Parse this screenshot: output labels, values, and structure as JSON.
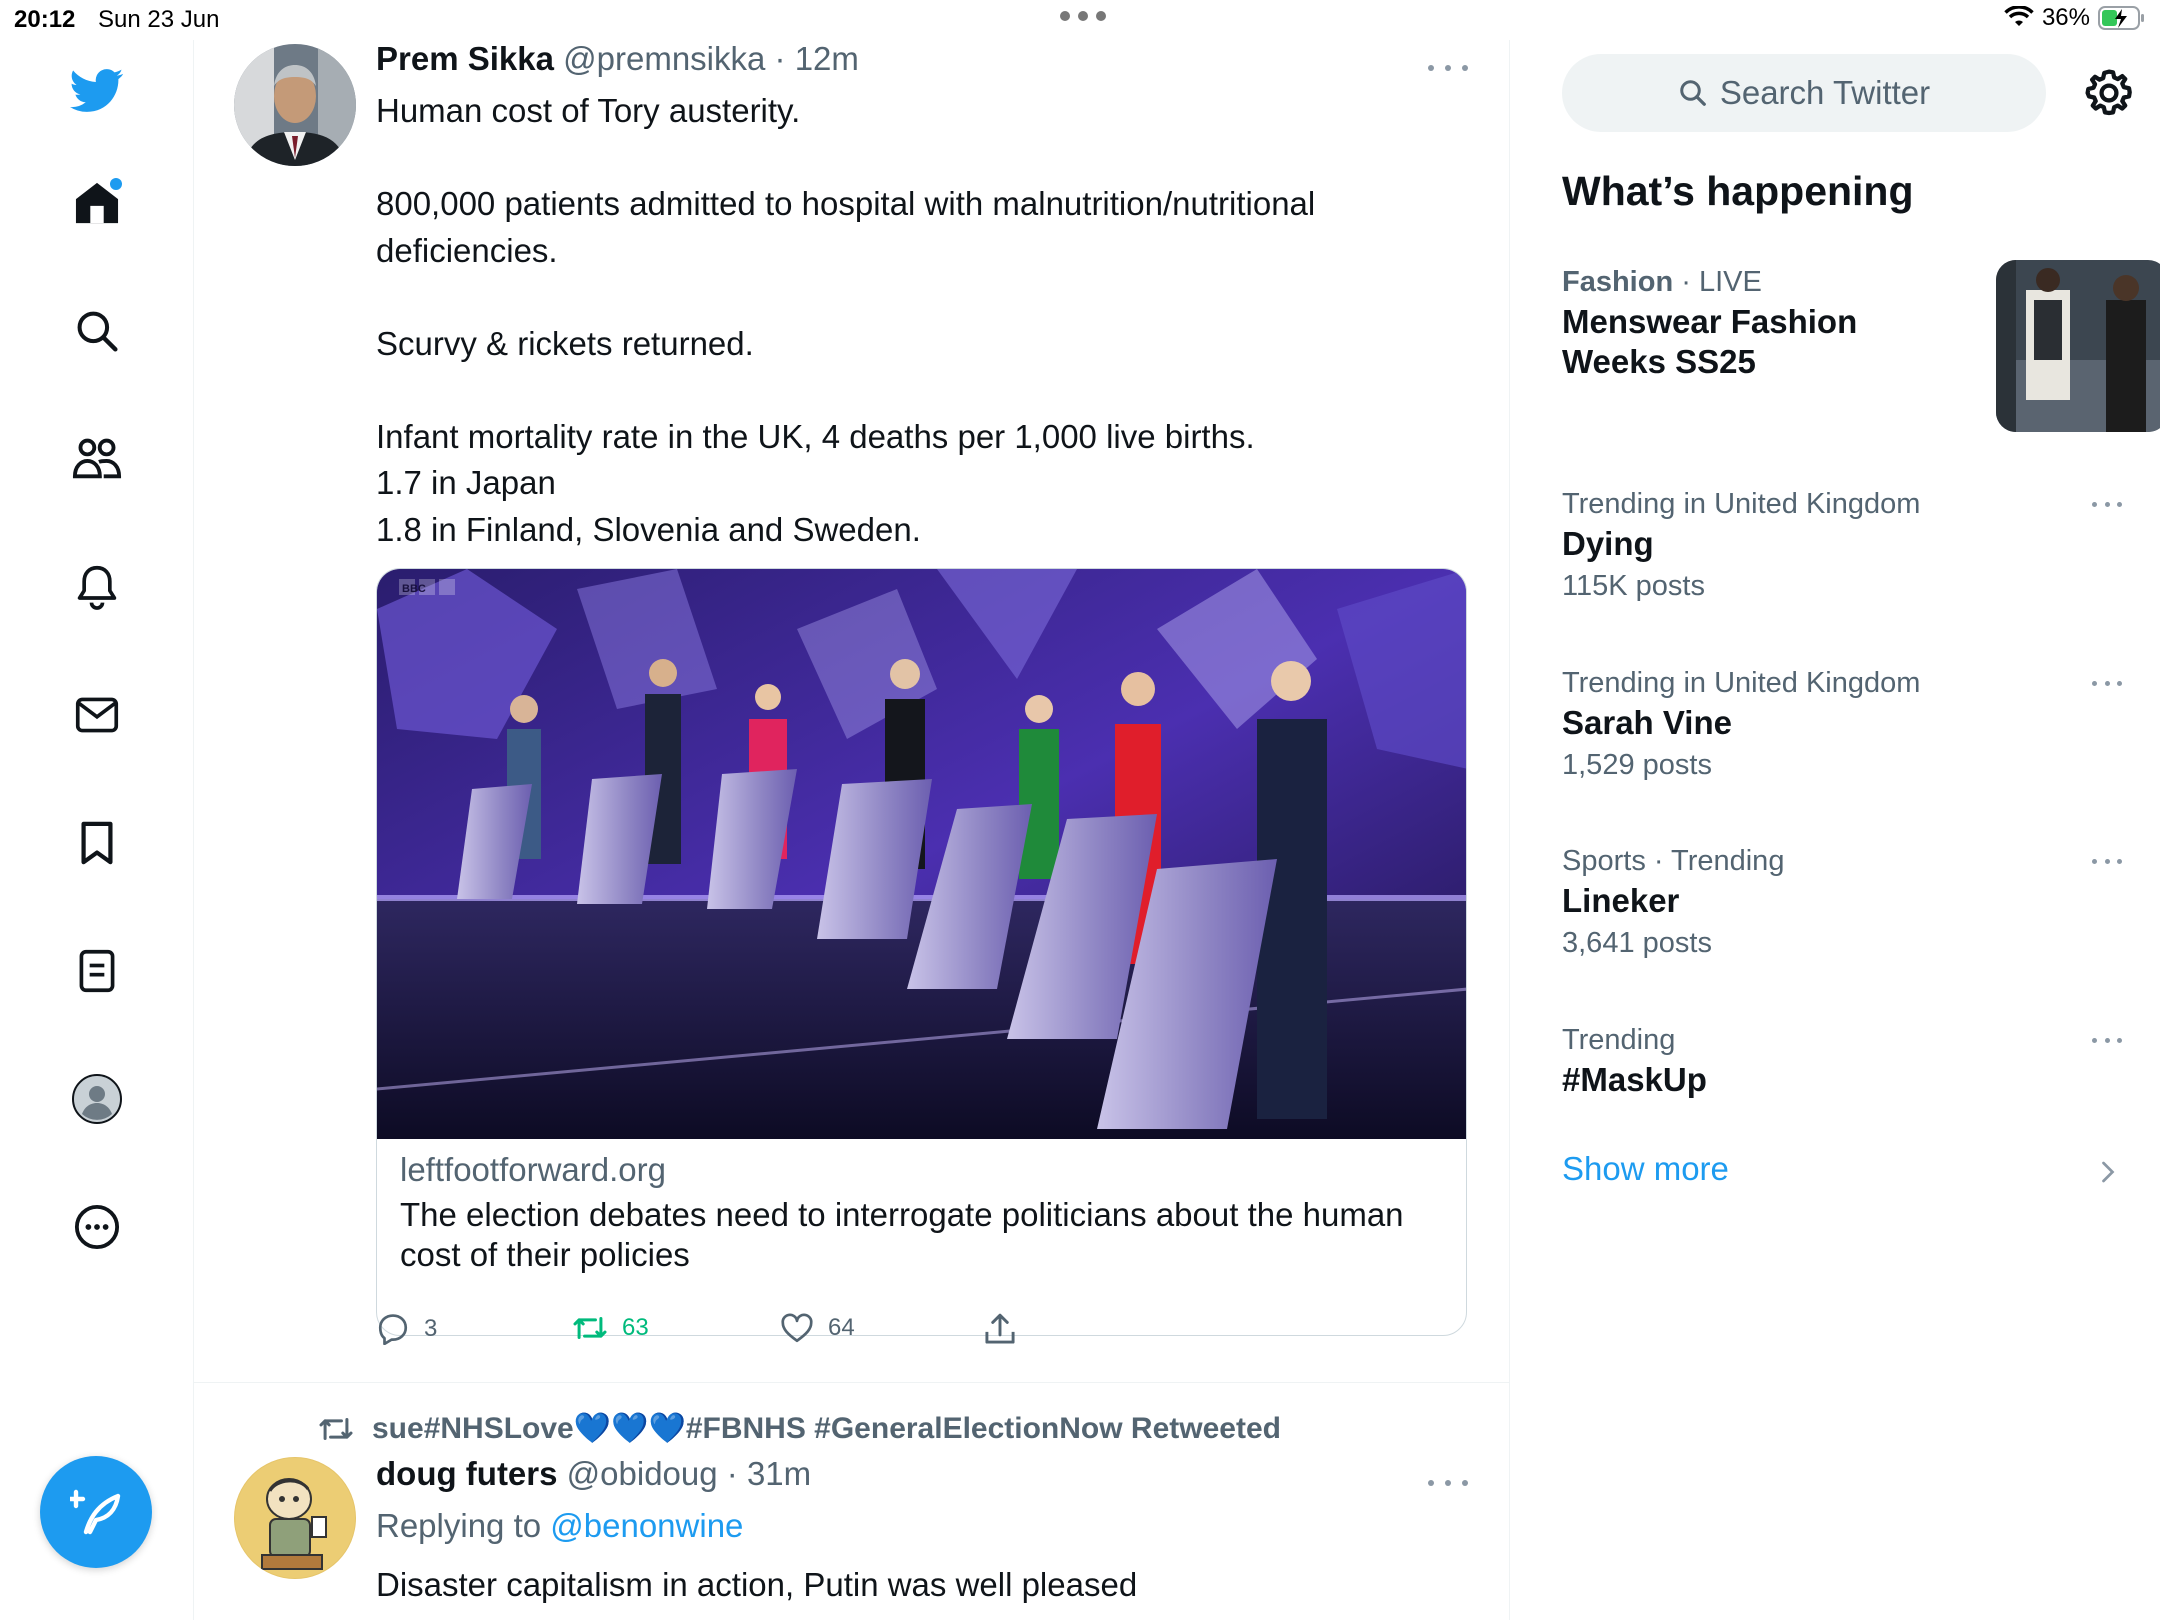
{
  "status_bar": {
    "time": "20:12",
    "date": "Sun 23 Jun",
    "battery": "36%"
  },
  "nav": {
    "items": [
      {
        "icon": "home-icon"
      },
      {
        "icon": "search-icon"
      },
      {
        "icon": "communities-icon"
      },
      {
        "icon": "notifications-icon"
      },
      {
        "icon": "messages-icon"
      },
      {
        "icon": "bookmarks-icon"
      },
      {
        "icon": "lists-icon"
      },
      {
        "icon": "profile-icon"
      },
      {
        "icon": "more-icon"
      }
    ],
    "accent": "#1d9bf0"
  },
  "tweet1": {
    "name": "Prem Sikka",
    "handle": "@premnsikka",
    "sep": " · ",
    "time": "12m",
    "lines": {
      "l1": "Human cost of Tory austerity.",
      "l2": "800,000 patients admitted to hospital with malnutrition/nutritional deficiencies.",
      "l3": "Scurvy & rickets returned.",
      "l4": "Infant mortality rate in the UK, 4 deaths per 1,000 live births.",
      "l5": "1.7 in Japan",
      "l6": "1.8 in Finland, Slovenia and Sweden."
    },
    "card": {
      "domain": "leftfootforward.org",
      "title": "The election debates need to interrogate politicians about the human cost of their policies",
      "image_badge": "BBC"
    },
    "actions": {
      "replies": "3",
      "retweets": "63",
      "likes": "64"
    }
  },
  "tweet2": {
    "retweeter": "sue#NHSLove",
    "hearts": "💙💙💙",
    "retweet_suffix": "#FBNHS #GeneralElectionNow Retweeted",
    "name": "doug futers",
    "handle": "@obidoug",
    "sep": " · ",
    "time": "31m",
    "replying_prefix": "Replying to ",
    "replying_to": "@benonwine",
    "body": "Disaster capitalism in action, Putin was well pleased"
  },
  "sidebar": {
    "search_placeholder": "Search Twitter",
    "whats_happening": "What’s happening",
    "trends": [
      {
        "category": "Fashion",
        "sep": " · ",
        "live": "LIVE",
        "title_l1": "Menswear Fashion",
        "title_l2": "Weeks SS25"
      },
      {
        "category": "Trending in United Kingdom",
        "title": "Dying",
        "count": "115K posts"
      },
      {
        "category": "Trending in United Kingdom",
        "title": "Sarah Vine",
        "count": "1,529 posts"
      },
      {
        "category": "Sports · Trending",
        "title": "Lineker",
        "count": "3,641 posts"
      },
      {
        "category": "Trending",
        "title": "#MaskUp",
        "count": ""
      }
    ],
    "show_more": "Show more"
  }
}
